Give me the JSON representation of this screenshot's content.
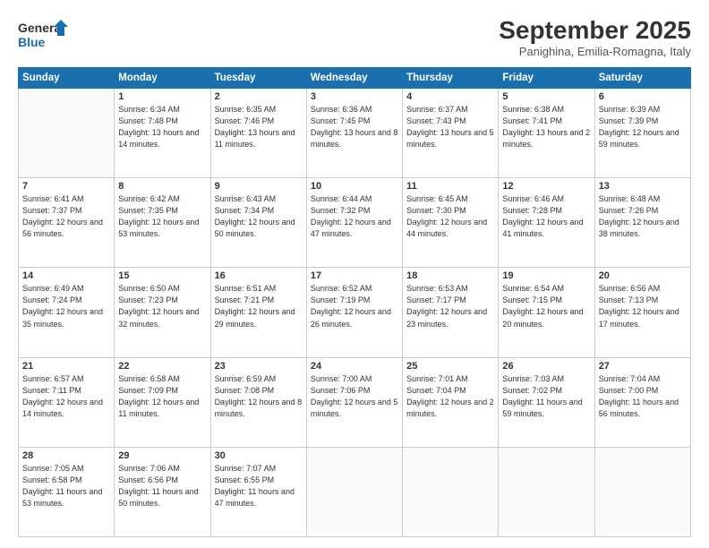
{
  "logo": {
    "line1": "General",
    "line2": "Blue"
  },
  "title": "September 2025",
  "subtitle": "Panighina, Emilia-Romagna, Italy",
  "days_of_week": [
    "Sunday",
    "Monday",
    "Tuesday",
    "Wednesday",
    "Thursday",
    "Friday",
    "Saturday"
  ],
  "weeks": [
    [
      {
        "num": "",
        "detail": ""
      },
      {
        "num": "1",
        "detail": "Sunrise: 6:34 AM\nSunset: 7:48 PM\nDaylight: 13 hours\nand 14 minutes."
      },
      {
        "num": "2",
        "detail": "Sunrise: 6:35 AM\nSunset: 7:46 PM\nDaylight: 13 hours\nand 11 minutes."
      },
      {
        "num": "3",
        "detail": "Sunrise: 6:36 AM\nSunset: 7:45 PM\nDaylight: 13 hours\nand 8 minutes."
      },
      {
        "num": "4",
        "detail": "Sunrise: 6:37 AM\nSunset: 7:43 PM\nDaylight: 13 hours\nand 5 minutes."
      },
      {
        "num": "5",
        "detail": "Sunrise: 6:38 AM\nSunset: 7:41 PM\nDaylight: 13 hours\nand 2 minutes."
      },
      {
        "num": "6",
        "detail": "Sunrise: 6:39 AM\nSunset: 7:39 PM\nDaylight: 12 hours\nand 59 minutes."
      }
    ],
    [
      {
        "num": "7",
        "detail": "Sunrise: 6:41 AM\nSunset: 7:37 PM\nDaylight: 12 hours\nand 56 minutes."
      },
      {
        "num": "8",
        "detail": "Sunrise: 6:42 AM\nSunset: 7:35 PM\nDaylight: 12 hours\nand 53 minutes."
      },
      {
        "num": "9",
        "detail": "Sunrise: 6:43 AM\nSunset: 7:34 PM\nDaylight: 12 hours\nand 50 minutes."
      },
      {
        "num": "10",
        "detail": "Sunrise: 6:44 AM\nSunset: 7:32 PM\nDaylight: 12 hours\nand 47 minutes."
      },
      {
        "num": "11",
        "detail": "Sunrise: 6:45 AM\nSunset: 7:30 PM\nDaylight: 12 hours\nand 44 minutes."
      },
      {
        "num": "12",
        "detail": "Sunrise: 6:46 AM\nSunset: 7:28 PM\nDaylight: 12 hours\nand 41 minutes."
      },
      {
        "num": "13",
        "detail": "Sunrise: 6:48 AM\nSunset: 7:26 PM\nDaylight: 12 hours\nand 38 minutes."
      }
    ],
    [
      {
        "num": "14",
        "detail": "Sunrise: 6:49 AM\nSunset: 7:24 PM\nDaylight: 12 hours\nand 35 minutes."
      },
      {
        "num": "15",
        "detail": "Sunrise: 6:50 AM\nSunset: 7:23 PM\nDaylight: 12 hours\nand 32 minutes."
      },
      {
        "num": "16",
        "detail": "Sunrise: 6:51 AM\nSunset: 7:21 PM\nDaylight: 12 hours\nand 29 minutes."
      },
      {
        "num": "17",
        "detail": "Sunrise: 6:52 AM\nSunset: 7:19 PM\nDaylight: 12 hours\nand 26 minutes."
      },
      {
        "num": "18",
        "detail": "Sunrise: 6:53 AM\nSunset: 7:17 PM\nDaylight: 12 hours\nand 23 minutes."
      },
      {
        "num": "19",
        "detail": "Sunrise: 6:54 AM\nSunset: 7:15 PM\nDaylight: 12 hours\nand 20 minutes."
      },
      {
        "num": "20",
        "detail": "Sunrise: 6:56 AM\nSunset: 7:13 PM\nDaylight: 12 hours\nand 17 minutes."
      }
    ],
    [
      {
        "num": "21",
        "detail": "Sunrise: 6:57 AM\nSunset: 7:11 PM\nDaylight: 12 hours\nand 14 minutes."
      },
      {
        "num": "22",
        "detail": "Sunrise: 6:58 AM\nSunset: 7:09 PM\nDaylight: 12 hours\nand 11 minutes."
      },
      {
        "num": "23",
        "detail": "Sunrise: 6:59 AM\nSunset: 7:08 PM\nDaylight: 12 hours\nand 8 minutes."
      },
      {
        "num": "24",
        "detail": "Sunrise: 7:00 AM\nSunset: 7:06 PM\nDaylight: 12 hours\nand 5 minutes."
      },
      {
        "num": "25",
        "detail": "Sunrise: 7:01 AM\nSunset: 7:04 PM\nDaylight: 12 hours\nand 2 minutes."
      },
      {
        "num": "26",
        "detail": "Sunrise: 7:03 AM\nSunset: 7:02 PM\nDaylight: 11 hours\nand 59 minutes."
      },
      {
        "num": "27",
        "detail": "Sunrise: 7:04 AM\nSunset: 7:00 PM\nDaylight: 11 hours\nand 56 minutes."
      }
    ],
    [
      {
        "num": "28",
        "detail": "Sunrise: 7:05 AM\nSunset: 6:58 PM\nDaylight: 11 hours\nand 53 minutes."
      },
      {
        "num": "29",
        "detail": "Sunrise: 7:06 AM\nSunset: 6:56 PM\nDaylight: 11 hours\nand 50 minutes."
      },
      {
        "num": "30",
        "detail": "Sunrise: 7:07 AM\nSunset: 6:55 PM\nDaylight: 11 hours\nand 47 minutes."
      },
      {
        "num": "",
        "detail": ""
      },
      {
        "num": "",
        "detail": ""
      },
      {
        "num": "",
        "detail": ""
      },
      {
        "num": "",
        "detail": ""
      }
    ]
  ]
}
